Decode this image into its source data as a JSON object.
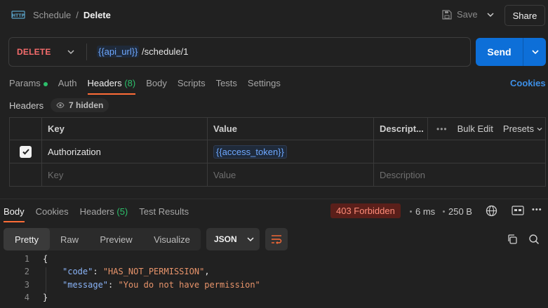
{
  "breadcrumb": {
    "parent": "Schedule",
    "separator": "/",
    "current": "Delete"
  },
  "header": {
    "save_label": "Save",
    "share_label": "Share"
  },
  "request": {
    "method": "DELETE",
    "url_var": "{{api_url}}",
    "url_path": " /schedule/1",
    "send_label": "Send"
  },
  "request_tabs": {
    "params": "Params",
    "auth": "Auth",
    "headers": "Headers",
    "headers_count": "(8)",
    "body": "Body",
    "scripts": "Scripts",
    "tests": "Tests",
    "settings": "Settings",
    "cookies": "Cookies"
  },
  "headers_section": {
    "label": "Headers",
    "hidden": "7 hidden"
  },
  "headers_table": {
    "columns": {
      "key": "Key",
      "value": "Value",
      "description": "Descript...",
      "bulk_edit": "Bulk Edit",
      "presets": "Presets"
    },
    "rows": [
      {
        "key": "Authorization",
        "value": "{{access_token}}",
        "checked": true
      }
    ],
    "placeholders": {
      "key": "Key",
      "value": "Value",
      "description": "Description"
    }
  },
  "response_tabs": {
    "body": "Body",
    "cookies": "Cookies",
    "headers": "Headers",
    "headers_count": "(5)",
    "test_results": "Test Results"
  },
  "response_meta": {
    "status": "403 Forbidden",
    "time": "6 ms",
    "size": "250 B"
  },
  "body_view": {
    "formats": [
      "Pretty",
      "Raw",
      "Preview",
      "Visualize"
    ],
    "selected_format": "Pretty",
    "language": "JSON"
  },
  "code_lines": [
    {
      "n": "1",
      "text": "{"
    },
    {
      "n": "2",
      "key": "\"code\"",
      "value": "\"HAS_NOT_PERMISSION\"",
      "trail": ","
    },
    {
      "n": "3",
      "key": "\"message\"",
      "value": "\"You do not have permission\"",
      "trail": ""
    },
    {
      "n": "4",
      "text": "}"
    }
  ],
  "colors": {
    "accent": "#ff6c37",
    "send": "#0d6fd8",
    "method": "#f56c6c",
    "status_bg": "#5a1f1a"
  }
}
